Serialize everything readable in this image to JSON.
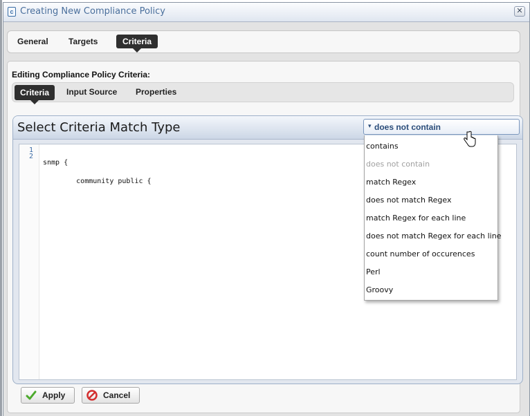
{
  "window": {
    "title": "Creating New Compliance Policy",
    "close_glyph": "✕",
    "app_icon_glyph": "c"
  },
  "main_tabs": [
    {
      "label": "General"
    },
    {
      "label": "Targets"
    },
    {
      "label": "Criteria",
      "active": true
    }
  ],
  "editing_label": "Editing Compliance Policy Criteria:",
  "sub_tabs": [
    {
      "label": "Criteria",
      "active": true
    },
    {
      "label": "Input Source"
    },
    {
      "label": "Properties"
    }
  ],
  "criteria_panel": {
    "title": "Select Criteria Match Type",
    "selected_match": "does not contain",
    "caret_glyph": "▾"
  },
  "editor": {
    "line_numbers": [
      "1",
      "2"
    ],
    "lines": [
      "snmp {",
      "        community public {"
    ]
  },
  "dropdown_options": [
    {
      "label": "contains",
      "disabled": false
    },
    {
      "label": "does not contain",
      "disabled": true
    },
    {
      "label": "match Regex",
      "disabled": false
    },
    {
      "label": "does not match Regex",
      "disabled": false
    },
    {
      "label": "match Regex for each line",
      "disabled": false
    },
    {
      "label": "does not match Regex for each line",
      "disabled": false
    },
    {
      "label": "count number of occurences",
      "disabled": false
    },
    {
      "label": "Perl",
      "disabled": false
    },
    {
      "label": "Groovy",
      "disabled": false
    }
  ],
  "footer": {
    "apply_label": "Apply",
    "cancel_label": "Cancel"
  },
  "colors": {
    "accent": "#4a6f9c",
    "active_tab": "#2f2f2f",
    "apply_check": "#4caa2c",
    "cancel_red": "#d32f2f"
  },
  "icons": [
    "app-icon",
    "close-icon",
    "hand-cursor-icon",
    "checkmark-icon",
    "cancel-icon"
  ]
}
